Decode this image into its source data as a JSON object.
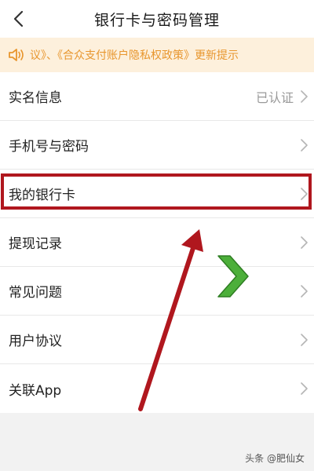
{
  "header": {
    "title": "银行卡与密码管理",
    "back_icon": "chevron-left-icon"
  },
  "notice": {
    "icon": "speaker-icon",
    "text": "议》、《合众支付账户隐私权政策》更新提示",
    "color": "#e8962e",
    "background": "#fdf0dc"
  },
  "menu": {
    "items": [
      {
        "label": "实名信息",
        "value": "已认证"
      },
      {
        "label": "手机号与密码",
        "value": ""
      },
      {
        "label": "我的银行卡",
        "value": ""
      },
      {
        "label": "提现记录",
        "value": ""
      },
      {
        "label": "常见问题",
        "value": ""
      },
      {
        "label": "用户协议",
        "value": ""
      },
      {
        "label": "关联App",
        "value": ""
      }
    ],
    "highlighted_index": 2,
    "highlight_color": "#b0171e"
  },
  "watermark": {
    "text": "头条 @肥仙女"
  },
  "colors": {
    "arrow_red": "#b0171e",
    "arrow_green": "#4caf3a"
  }
}
